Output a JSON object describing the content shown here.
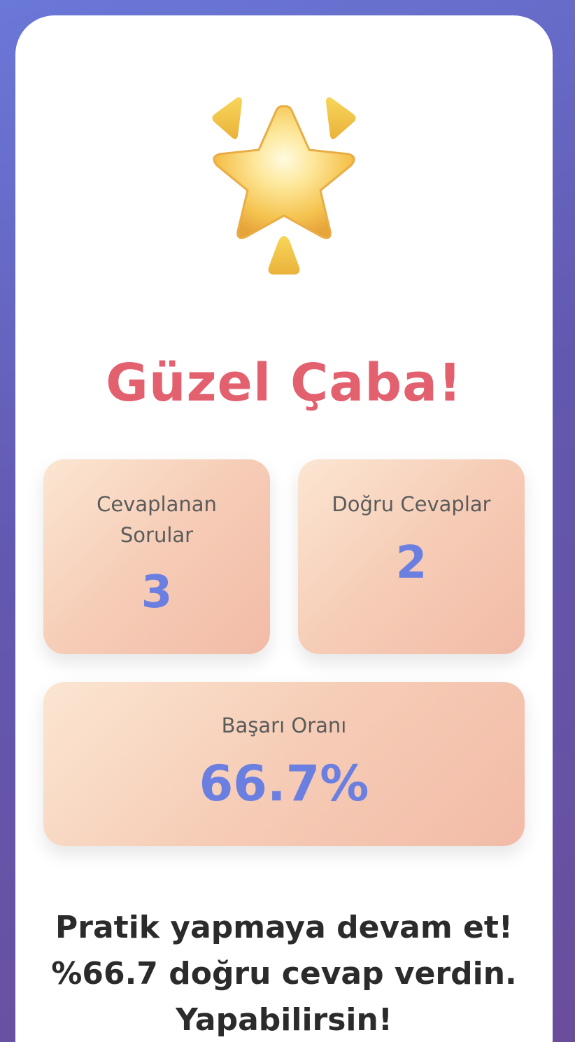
{
  "result": {
    "icon": "glowing-star-icon",
    "title": "Güzel Çaba!",
    "title_color": "#e3606f"
  },
  "stats": {
    "answered": {
      "label": "Cevaplanan Sorular",
      "value": "3"
    },
    "correct": {
      "label": "Doğru Cevaplar",
      "value": "2"
    },
    "rate": {
      "label": "Başarı Oranı",
      "value": "66.7%"
    },
    "value_color": "#6b7fe0"
  },
  "message": {
    "text": "Pratik yapmaya devam et! %66.7 doğru cevap verdin. Yapabilirsin!"
  },
  "colors": {
    "background_start": "#6a78d8",
    "background_end": "#6a4e9c",
    "card": "#ffffff",
    "stat_card_start": "#fbe6d2",
    "stat_card_end": "#f2bba7"
  }
}
